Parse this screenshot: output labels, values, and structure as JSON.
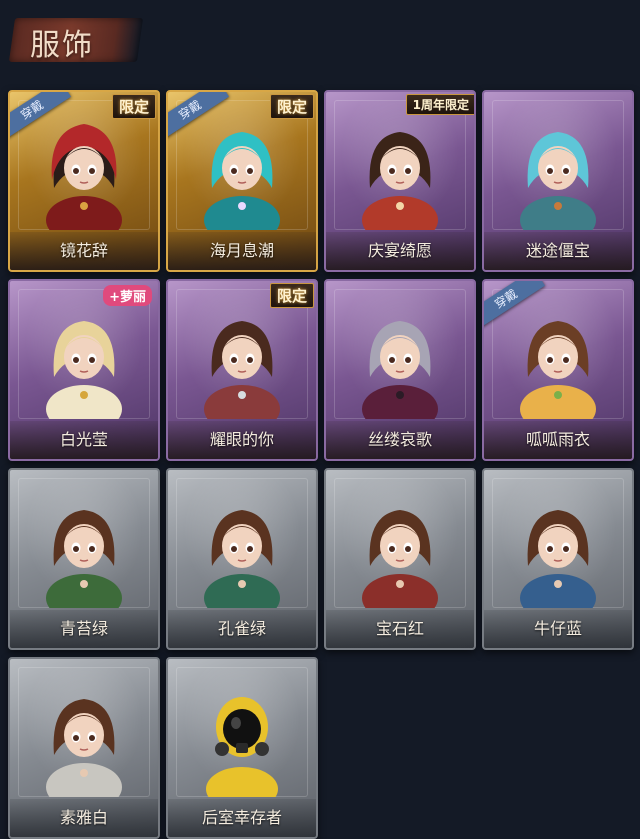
{
  "header": {
    "title": "服饰"
  },
  "badges": {
    "equipped": "穿戴"
  },
  "tags": {
    "limited": "限定",
    "anniversary": "1周年限定",
    "loli": "+萝丽"
  },
  "colors": {
    "gold_frame": "#d8a746",
    "purple_frame": "#8a6aa3",
    "gray_frame": "#777c83",
    "background": "#141a26",
    "equipped_badge": "#4d6fa0"
  },
  "costumes": [
    {
      "name": "镜花辞",
      "rarity": "gold",
      "tag": "限定",
      "equipped": true,
      "portrait": "red-hood-girl"
    },
    {
      "name": "海月息潮",
      "rarity": "gold",
      "tag": "限定",
      "equipped": true,
      "portrait": "cyan-haired-girl"
    },
    {
      "name": "庆宴绮愿",
      "rarity": "purple",
      "tag": "1周年限定",
      "equipped": false,
      "portrait": "cake-girl"
    },
    {
      "name": "迷途僵宝",
      "rarity": "purple",
      "tag": "",
      "equipped": false,
      "portrait": "blue-haired-girl"
    },
    {
      "name": "白光莹",
      "rarity": "purple",
      "tag": "+萝丽",
      "equipped": false,
      "portrait": "blonde-crown-girl"
    },
    {
      "name": "耀眼的你",
      "rarity": "purple",
      "tag": "限定",
      "equipped": false,
      "portrait": "cowboy-hat-girl"
    },
    {
      "name": "丝缕哀歌",
      "rarity": "purple",
      "tag": "",
      "equipped": false,
      "portrait": "gray-haired-girl"
    },
    {
      "name": "呱呱雨衣",
      "rarity": "purple",
      "tag": "",
      "equipped": true,
      "portrait": "frog-hat-girl"
    },
    {
      "name": "青苔绿",
      "rarity": "gray",
      "tag": "",
      "equipped": false,
      "portrait": "girl-green-coat"
    },
    {
      "name": "孔雀绿",
      "rarity": "gray",
      "tag": "",
      "equipped": false,
      "portrait": "girl-teal-coat"
    },
    {
      "name": "宝石红",
      "rarity": "gray",
      "tag": "",
      "equipped": false,
      "portrait": "girl-red-coat"
    },
    {
      "name": "牛仔蓝",
      "rarity": "gray",
      "tag": "",
      "equipped": false,
      "portrait": "girl-blue-coat"
    },
    {
      "name": "素雅白",
      "rarity": "gray",
      "tag": "",
      "equipped": false,
      "portrait": "girl-white-coat"
    },
    {
      "name": "后室幸存者",
      "rarity": "gray",
      "tag": "",
      "equipped": false,
      "portrait": "hazmat-survivor"
    }
  ]
}
